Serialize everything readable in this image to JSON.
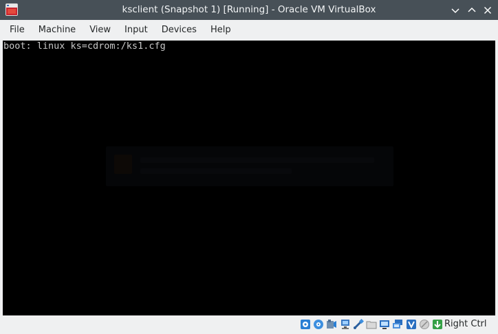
{
  "window": {
    "title": "ksclient (Snapshot 1) [Running] - Oracle VM VirtualBox"
  },
  "menu": {
    "items": [
      "File",
      "Machine",
      "View",
      "Input",
      "Devices",
      "Help"
    ]
  },
  "console": {
    "line": "boot: linux ks=cdrom:/ks1.cfg"
  },
  "statusbar": {
    "icons": [
      "hard-disk-icon",
      "optical-drive-icon",
      "audio-icon",
      "network-icon",
      "usb-icon",
      "shared-folders-icon",
      "display-icon",
      "video-capture-icon",
      "virtualization-icon",
      "mouse-integration-icon",
      "host-key-icon"
    ],
    "host_key": "Right Ctrl"
  },
  "colors": {
    "titlebar": "#475057",
    "menubar": "#eff0f1",
    "screen": "#000000",
    "console_text": "#c8c8c8",
    "accent": "#1d6fc4"
  }
}
